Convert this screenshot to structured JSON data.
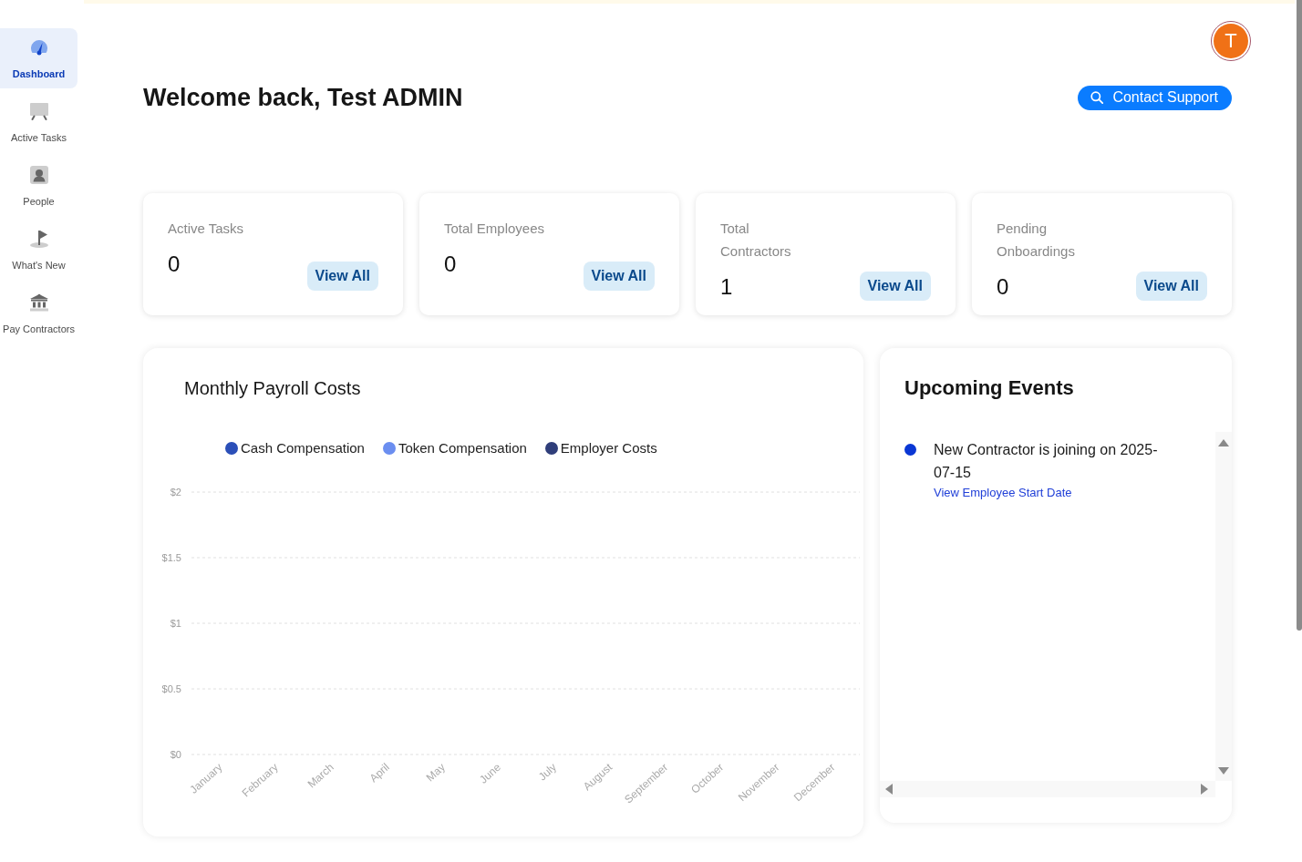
{
  "sidebar": {
    "items": [
      {
        "label": "Dashboard",
        "selected": true
      },
      {
        "label": "Active Tasks",
        "selected": false
      },
      {
        "label": "People",
        "selected": false
      },
      {
        "label": "What's New",
        "selected": false
      },
      {
        "label": "Pay Contractors",
        "selected": false
      }
    ]
  },
  "header": {
    "avatar_initial": "T",
    "greeting": "Welcome back, Test ADMIN",
    "support_button": "Contact Support"
  },
  "stats": [
    {
      "label": "Active Tasks",
      "value": "0",
      "button": "View All"
    },
    {
      "label": "Total Employees",
      "value": "0",
      "button": "View All"
    },
    {
      "label": "Total Contractors",
      "value": "1",
      "button": "View All"
    },
    {
      "label": "Pending Onboardings",
      "value": "0",
      "button": "View All"
    }
  ],
  "payroll_chart": {
    "title": "Monthly Payroll Costs",
    "chart_data": {
      "type": "bar",
      "categories": [
        "January",
        "February",
        "March",
        "April",
        "May",
        "June",
        "July",
        "August",
        "September",
        "October",
        "November",
        "December"
      ],
      "series": [
        {
          "name": "Cash Compensation",
          "color": "#2b4fb8",
          "values": [
            0,
            0,
            0,
            0,
            0,
            0,
            0,
            0,
            0,
            0,
            0,
            0
          ]
        },
        {
          "name": "Token Compensation",
          "color": "#6b8ef0",
          "values": [
            0,
            0,
            0,
            0,
            0,
            0,
            0,
            0,
            0,
            0,
            0,
            0
          ]
        },
        {
          "name": "Employer Costs",
          "color": "#2f3e7a",
          "values": [
            0,
            0,
            0,
            0,
            0,
            0,
            0,
            0,
            0,
            0,
            0,
            0
          ]
        }
      ],
      "ylim": [
        0,
        2
      ],
      "yticks": [
        {
          "value": 2,
          "label": "$2"
        },
        {
          "value": 1.5,
          "label": "$1.5"
        },
        {
          "value": 1,
          "label": "$1"
        },
        {
          "value": 0.5,
          "label": "$0.5"
        },
        {
          "value": 0,
          "label": "$0"
        }
      ],
      "grid": true
    }
  },
  "upcoming_events": {
    "title": "Upcoming Events",
    "items": [
      {
        "text": "New Contractor is joining on 2025-07-15",
        "link": "View Employee Start Date"
      }
    ]
  }
}
